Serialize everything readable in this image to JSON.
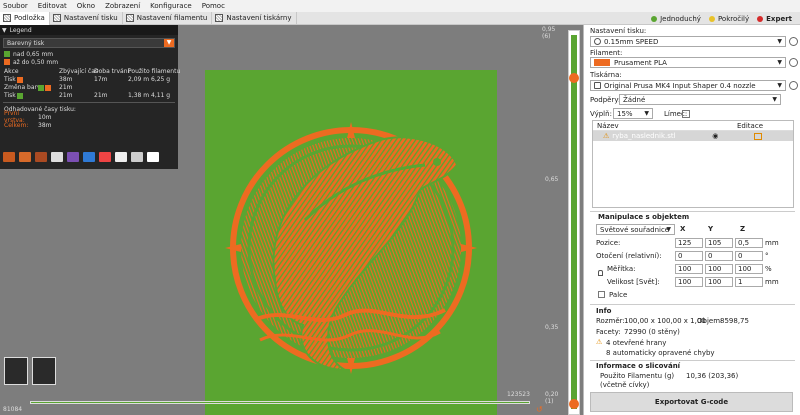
{
  "menu": [
    "Soubor",
    "Editovat",
    "Okno",
    "Zobrazení",
    "Konfigurace",
    "Pomoc"
  ],
  "tabs": [
    {
      "label": "Podložka",
      "active": true
    },
    {
      "label": "Nastavení tisku",
      "active": false
    },
    {
      "label": "Nastavení filamentu",
      "active": false
    },
    {
      "label": "Nastavení tiskárny",
      "active": false
    }
  ],
  "modes": [
    {
      "label": "Jednoduchý",
      "color": "#5aa531"
    },
    {
      "label": "Pokročilý",
      "color": "#e8c22a"
    },
    {
      "label": "Expert",
      "color": "#d52b2b"
    }
  ],
  "legend": {
    "title": "Legend",
    "view_type": "Barevný tisk",
    "ranges": [
      {
        "label": "nad 0,65 mm",
        "color": "#5aa531"
      },
      {
        "label": "až do 0,50 mm",
        "color": "#ed6b21"
      }
    ],
    "columns": [
      "Akce",
      "Zbývající čas",
      "Doba trvání",
      "Použito filamentu"
    ],
    "rows": [
      {
        "action": "Tisk",
        "remaining": "38m",
        "duration": "17m",
        "filament": "2,09 m   6,25 g"
      },
      {
        "action": "Změna barvy",
        "remaining": "21m",
        "duration": "",
        "filament": ""
      },
      {
        "action": "Tisk",
        "remaining": "21m",
        "duration": "21m",
        "filament": "1,38 m   4,11 g"
      }
    ],
    "estimates_title": "Odhadované časy tisku:",
    "first_layer_label": "První vrstva:",
    "first_layer_value": "10m",
    "total_label": "Celkem:",
    "total_value": "38m"
  },
  "viewport": {
    "bottom_left_value": "81084",
    "bottom_right_value": "123523"
  },
  "slider": {
    "top_value": "0,95",
    "top_layer": "(6)",
    "mid_value": "0,65",
    "lower_value": "0,35",
    "bottom_value": "0,20",
    "bottom_layer": "(1)",
    "fill_color": "#5aa531",
    "change_color": "#ed6b21"
  },
  "panel": {
    "print_settings_label": "Nastavení tisku:",
    "print_settings_value": "0.15mm SPEED",
    "filament_label": "Filament:",
    "filament_value": "Prusament PLA",
    "filament_color": "#ed6b21",
    "printer_label": "Tiskárna:",
    "printer_value": "Original Prusa MK4 Input Shaper 0.4 nozzle",
    "supports_label": "Podpěry:",
    "supports_value": "Žádné",
    "infill_label": "Výplň:",
    "infill_value": "15%",
    "brim_label": "Límec:",
    "list_col_name": "Název",
    "list_col_edit": "Editace",
    "object_name": "ryba_naslednik.stl",
    "manip_title": "Manipulace s objektem",
    "coord_system": "Světové souřadnice",
    "axes": [
      "X",
      "Y",
      "Z"
    ],
    "position_label": "Pozice:",
    "position": [
      "125",
      "105",
      "0,5"
    ],
    "position_unit": "mm",
    "rotation_label": "Otočení (relativní):",
    "rotation": [
      "0",
      "0",
      "0"
    ],
    "rotation_unit": "°",
    "scale_label": "Měřítka:",
    "scale": [
      "100",
      "100",
      "100"
    ],
    "scale_unit": "%",
    "size_label": "Velikost [Svět]:",
    "size": [
      "100",
      "100",
      "1"
    ],
    "size_unit": "mm",
    "inches_label": "Palce",
    "info_title": "Info",
    "size_info_label": "Rozměr:",
    "size_info_value": "100,00 x 100,00 x 1,00",
    "volume_label": "Objem:",
    "volume_value": "8598,75",
    "facets_label": "Facety:",
    "facets_value": "72990 (0 stěny)",
    "warning_edges": "4 otevřené hrany",
    "warning_repaired": "8 automaticky opravené chyby",
    "slice_title": "Informace o slicování",
    "filament_used_label": "Použito Filamentu (g)",
    "filament_used_sub": "(včetně cívky)",
    "filament_used_value": "10,36 (203,36)",
    "export_label": "Exportovat G-code"
  }
}
